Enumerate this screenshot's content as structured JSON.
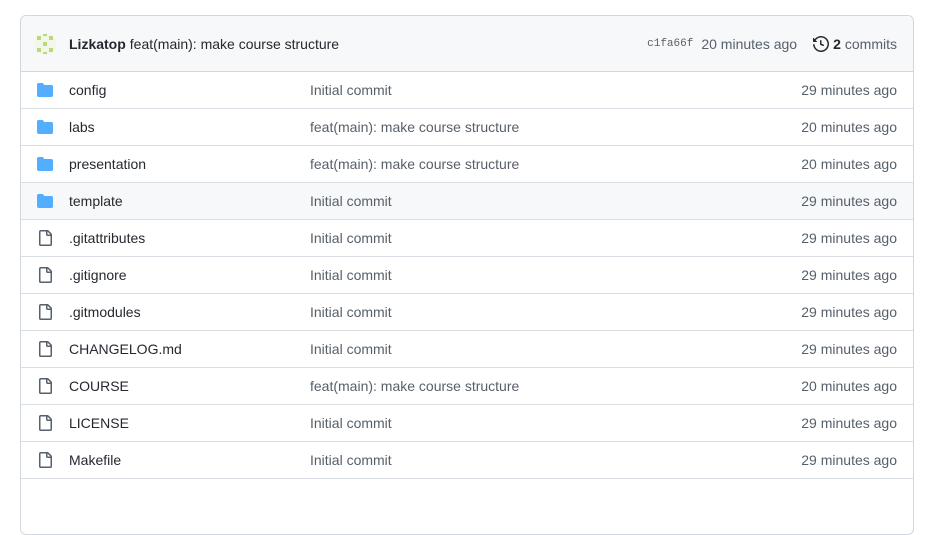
{
  "latest_commit": {
    "author": "Lizkatop",
    "message": "feat(main): make course structure",
    "sha": "c1fa66f",
    "age": "20 minutes ago",
    "history_count": "2",
    "history_label": "commits"
  },
  "colors": {
    "folder": "#54aeff",
    "file_icon": "#57606a",
    "avatar": "#b9d97b"
  },
  "files": [
    {
      "name": "config",
      "type": "folder",
      "message": "Initial commit",
      "age": "29 minutes ago"
    },
    {
      "name": "labs",
      "type": "folder",
      "message": "feat(main): make course structure",
      "age": "20 minutes ago"
    },
    {
      "name": "presentation",
      "type": "folder",
      "message": "feat(main): make course structure",
      "age": "20 minutes ago"
    },
    {
      "name": "template",
      "type": "folder",
      "message": "Initial commit",
      "age": "29 minutes ago"
    },
    {
      "name": ".gitattributes",
      "type": "file",
      "message": "Initial commit",
      "age": "29 minutes ago"
    },
    {
      "name": ".gitignore",
      "type": "file",
      "message": "Initial commit",
      "age": "29 minutes ago"
    },
    {
      "name": ".gitmodules",
      "type": "file",
      "message": "Initial commit",
      "age": "29 minutes ago"
    },
    {
      "name": "CHANGELOG.md",
      "type": "file",
      "message": "Initial commit",
      "age": "29 minutes ago"
    },
    {
      "name": "COURSE",
      "type": "file",
      "message": "feat(main): make course structure",
      "age": "20 minutes ago"
    },
    {
      "name": "LICENSE",
      "type": "file",
      "message": "Initial commit",
      "age": "29 minutes ago"
    },
    {
      "name": "Makefile",
      "type": "file",
      "message": "Initial commit",
      "age": "29 minutes ago"
    }
  ]
}
